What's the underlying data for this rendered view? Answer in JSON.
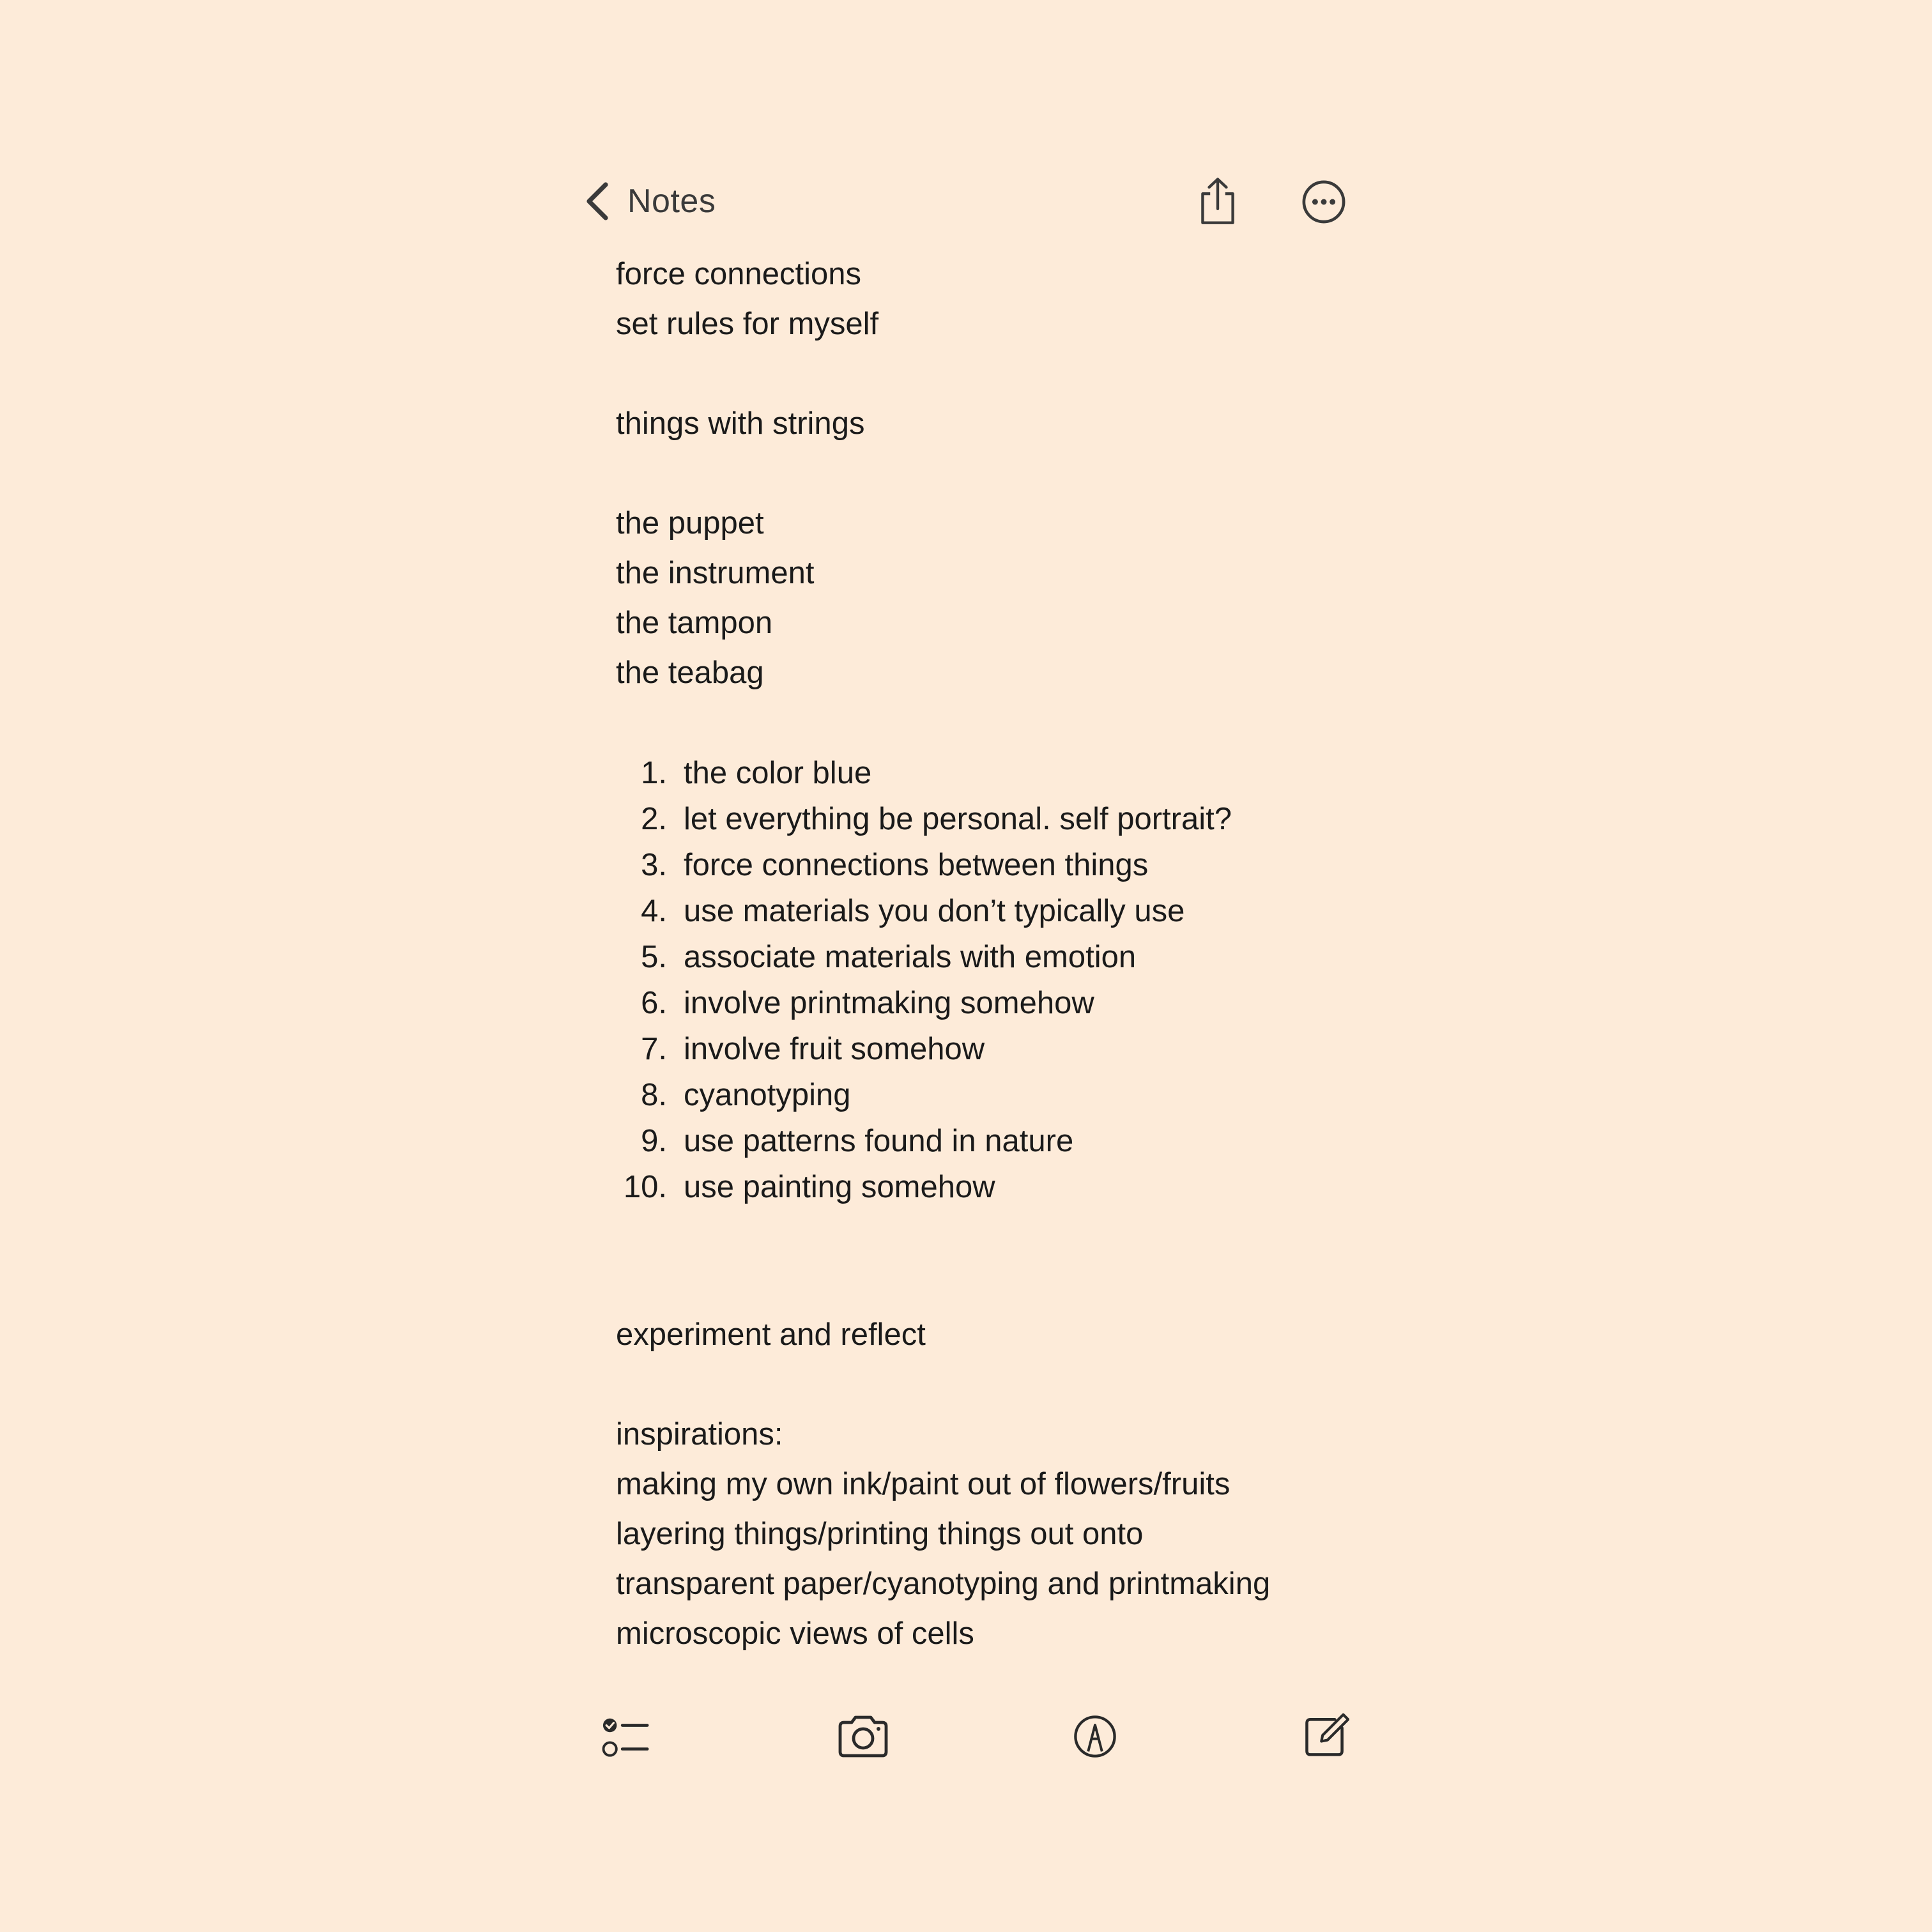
{
  "nav": {
    "back_label": "Notes",
    "back_icon": "chevron-left-icon",
    "share_icon": "share-icon",
    "more_icon": "ellipsis-circle-icon"
  },
  "note": {
    "lines_top": [
      "force connections",
      "set rules for myself"
    ],
    "line_strings": "things with strings",
    "things": [
      "the puppet",
      "the instrument",
      "the tampon",
      "the teabag"
    ],
    "list": [
      {
        "marker": "1.",
        "text": "the color blue"
      },
      {
        "marker": "2.",
        "text": "let everything be personal. self portrait?"
      },
      {
        "marker": "3.",
        "text": "force connections between things"
      },
      {
        "marker": "4.",
        "text": "use materials you don’t typically use"
      },
      {
        "marker": "5.",
        "text": "associate materials with emotion"
      },
      {
        "marker": "6.",
        "text": "involve printmaking somehow"
      },
      {
        "marker": "7.",
        "text": "involve fruit somehow"
      },
      {
        "marker": "8.",
        "text": "cyanotyping"
      },
      {
        "marker": "9.",
        "text": "use patterns found in nature"
      },
      {
        "marker": "10.",
        "text": "use painting somehow"
      }
    ],
    "experiment": "experiment and reflect",
    "inspirations": [
      "inspirations:",
      "making my own ink/paint out of flowers/fruits",
      "layering things/printing things out onto",
      "transparent paper/cyanotyping and printmaking",
      "microscopic views of cells"
    ]
  },
  "toolbar": {
    "checklist_icon": "checklist-icon",
    "camera_icon": "camera-icon",
    "markup_icon": "markup-pen-icon",
    "compose_icon": "compose-icon"
  },
  "colors": {
    "background": "#FDEBD9",
    "text": "#1a1a1a",
    "icon": "#3a3a3a"
  }
}
